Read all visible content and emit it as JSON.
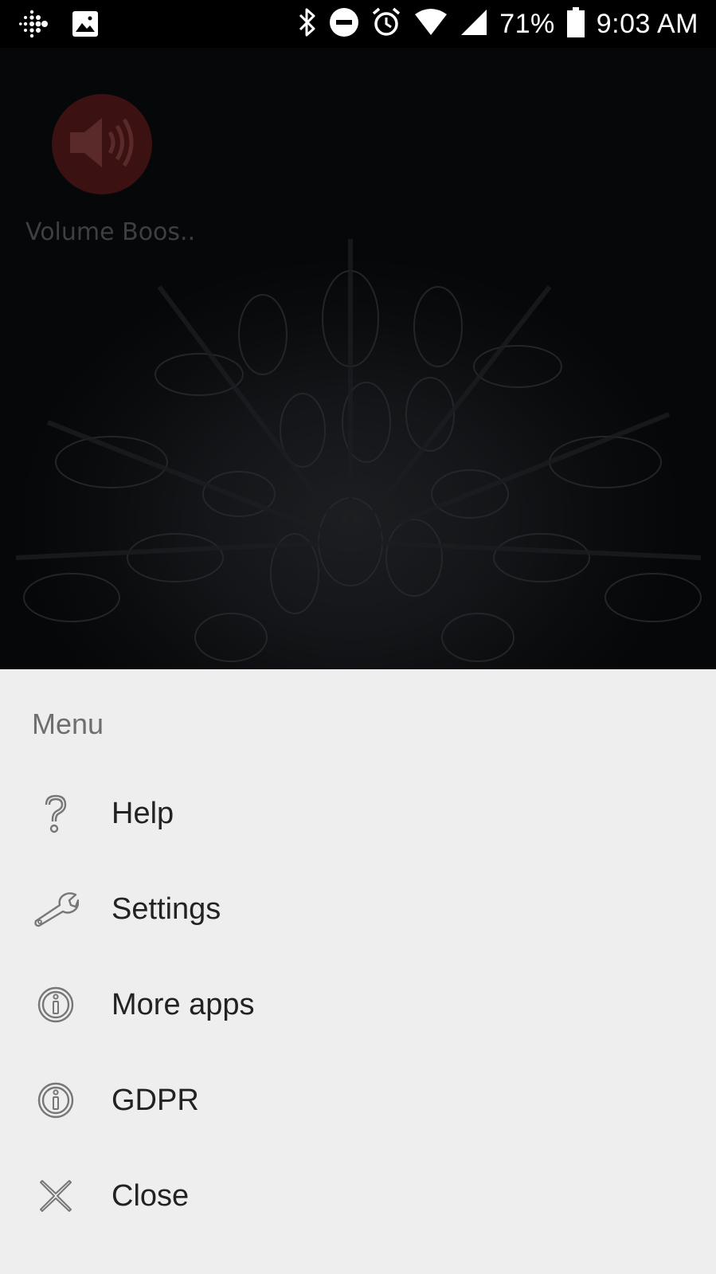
{
  "status_bar": {
    "left_icons": [
      "fitbit-icon",
      "image-icon"
    ],
    "right_icons": [
      "bluetooth-icon",
      "do-not-disturb-icon",
      "alarm-icon",
      "wifi-icon",
      "cell-signal-icon",
      "battery-icon"
    ],
    "battery_percent": "71%",
    "time": "9:03 AM"
  },
  "home": {
    "app_icon": "speaker-icon",
    "app_label": "Volume Boos.."
  },
  "menu": {
    "title": "Menu",
    "items": [
      {
        "label": "Help",
        "icon": "question-icon"
      },
      {
        "label": "Settings",
        "icon": "wrench-icon"
      },
      {
        "label": "More apps",
        "icon": "info-icon"
      },
      {
        "label": "GDPR",
        "icon": "info-icon"
      },
      {
        "label": "Close",
        "icon": "close-icon"
      }
    ]
  },
  "colors": {
    "sheet_bg": "#eeeeee",
    "status_bg": "#000000",
    "app_icon_bg": "#3b1112"
  }
}
